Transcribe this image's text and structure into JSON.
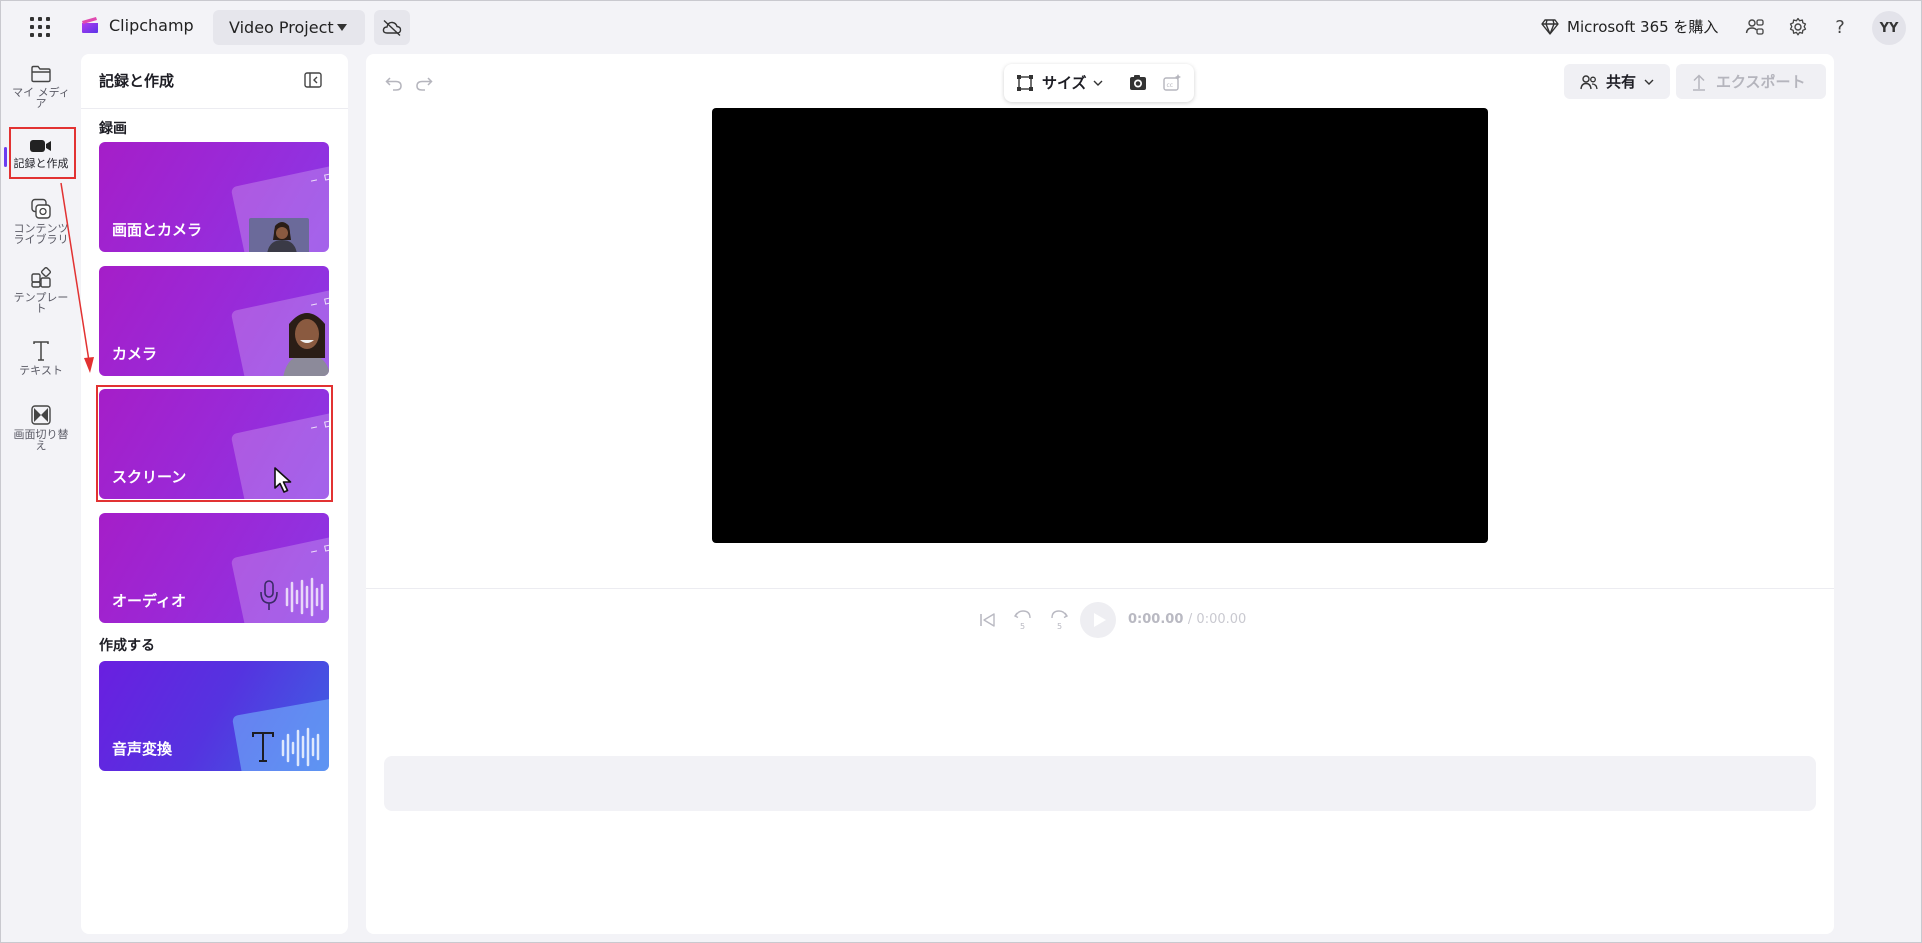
{
  "app": {
    "name": "Clipchamp",
    "project_name": "Video Project",
    "accent": "#6b3cf0",
    "icons": {
      "apps": "waffle-icon",
      "cloud": "cloud-off-icon"
    }
  },
  "topbar_right": {
    "buy_label": "Microsoft 365 を購入",
    "avatar_initials": "YY",
    "icons": [
      "diamond-icon",
      "share-people-icon",
      "gear-icon",
      "help-icon"
    ]
  },
  "rail": {
    "items": [
      {
        "label": "マイ メディア",
        "icon": "folder-icon"
      },
      {
        "label": "記録と作成",
        "icon": "video-camera-icon",
        "active": true
      },
      {
        "label": "コンテンツ ライブラリ",
        "icon": "library-icon"
      },
      {
        "label": "テンプレート",
        "icon": "templates-icon"
      },
      {
        "label": "テキスト",
        "icon": "text-icon"
      },
      {
        "label": "画面切り替え",
        "icon": "transitions-icon"
      }
    ]
  },
  "panel": {
    "title": "記録と作成",
    "section_record": "録画",
    "section_create": "作成する",
    "cards": [
      {
        "label": "画面とカメラ"
      },
      {
        "label": "カメラ"
      },
      {
        "label": "スクリーン"
      },
      {
        "label": "オーディオ"
      },
      {
        "label": "音声変換"
      }
    ]
  },
  "editor": {
    "size_label": "サイズ",
    "share_label": "共有",
    "export_label": "エクスポート",
    "time_current": "0:00.00",
    "time_total": "/ 0:00.00"
  },
  "annotation_color": "#e23232"
}
